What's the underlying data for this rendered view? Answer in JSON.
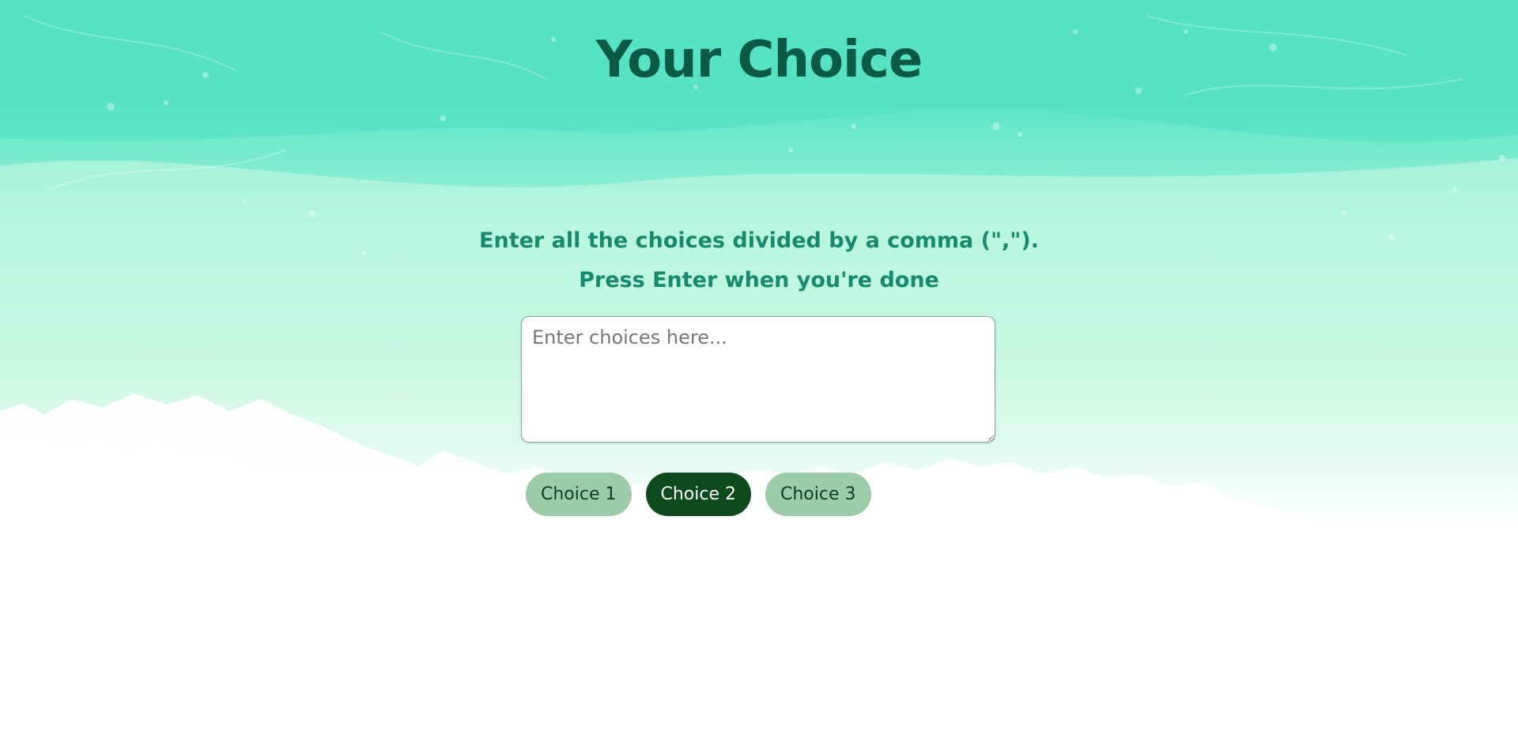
{
  "page": {
    "title": "Your Choice",
    "instruction_line1": "Enter all the choices divided by a comma (\",\").",
    "instruction_line2": "Press Enter when you're done"
  },
  "input": {
    "placeholder": "Enter choices here...",
    "value": ""
  },
  "choices": [
    {
      "label": "Choice 1",
      "selected": false
    },
    {
      "label": "Choice 2",
      "selected": true
    },
    {
      "label": "Choice 3",
      "selected": false
    }
  ],
  "colors": {
    "background_top": "#5ee6c9",
    "background_mid": "#c6f6e0",
    "background_bottom": "#ffffff",
    "title": "#0b5a46",
    "instruction": "#168a6c",
    "choice_button": "#9ccba8",
    "choice_button_selected": "#0d4a1c"
  }
}
